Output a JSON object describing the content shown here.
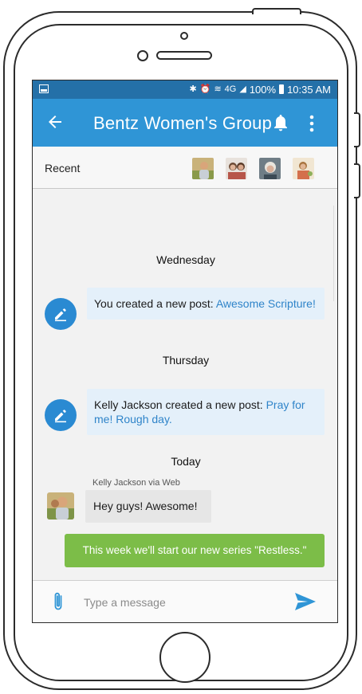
{
  "status_bar": {
    "battery": "100%",
    "time": "10:35 AM",
    "network": "4G",
    "icons": [
      "screenshot-icon",
      "bluetooth-icon",
      "alarm-icon",
      "wifi-icon",
      "signal-icon",
      "battery-icon"
    ]
  },
  "app_bar": {
    "title": "Bentz Women's Group",
    "icons": [
      "back-arrow-icon",
      "bell-icon",
      "more-vert-icon"
    ],
    "color": "#2f95d6"
  },
  "recent": {
    "label": "Recent",
    "avatars": [
      "avatar-1",
      "avatar-2",
      "avatar-3",
      "avatar-4"
    ]
  },
  "feed": {
    "day1": "Wednesday",
    "post1": {
      "prefix": "You created a new post: ",
      "link": "Awesome Scripture!"
    },
    "day2": "Thursday",
    "post2": {
      "prefix": "Kelly Jackson created a new post: ",
      "link": "Pray for me! Rough day."
    },
    "day3": "Today",
    "message": {
      "meta": "Kelly Jackson via Web",
      "text": "Hey guys!  Awesome!"
    },
    "outgoing": {
      "text": "This week we'll start our new series \"Restless.\"",
      "color": "#7cbd48"
    }
  },
  "composer": {
    "placeholder": "Type a message",
    "value": ""
  },
  "colors": {
    "status_bar": "#2470a8",
    "link": "#2f84c9",
    "system_avatar": "#2a8ad2"
  }
}
